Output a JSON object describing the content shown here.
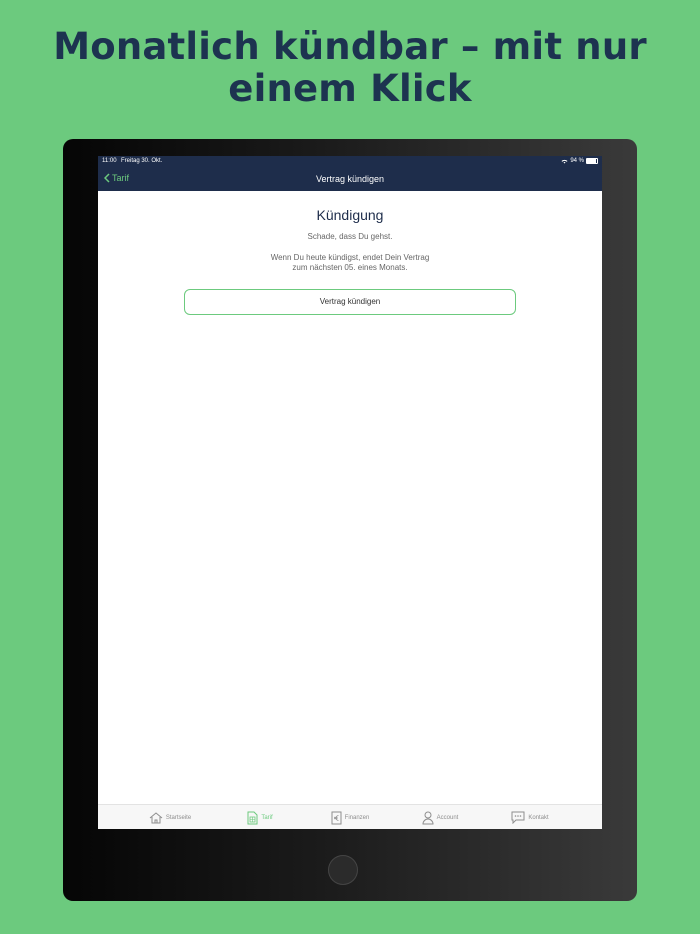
{
  "headline": {
    "line1": "Monatlich kündbar – mit nur",
    "line2": "einem Klick"
  },
  "status": {
    "time": "11:00",
    "date": "Freitag 30. Okt.",
    "battery": "94 %"
  },
  "navbar": {
    "back_label": "Tarif",
    "title": "Vertrag kündigen"
  },
  "content": {
    "title": "Kündigung",
    "subtitle": "Schade, dass Du gehst.",
    "info_line1": "Wenn Du heute kündigst, endet Dein Vertrag",
    "info_line2": "zum nächsten 05. eines Monats.",
    "button_label": "Vertrag kündigen"
  },
  "tabbar": {
    "items": [
      {
        "label": "Startseite",
        "icon": "home-icon",
        "active": false
      },
      {
        "label": "Tarif",
        "icon": "sim-card-icon",
        "active": true
      },
      {
        "label": "Finanzen",
        "icon": "euro-icon",
        "active": false
      },
      {
        "label": "Account",
        "icon": "user-icon",
        "active": false
      },
      {
        "label": "Kontakt",
        "icon": "chat-icon",
        "active": false
      }
    ]
  },
  "colors": {
    "background": "#6cca7e",
    "headline": "#1d3350",
    "navbar": "#1e2d4b",
    "accent": "#6cca7e"
  }
}
